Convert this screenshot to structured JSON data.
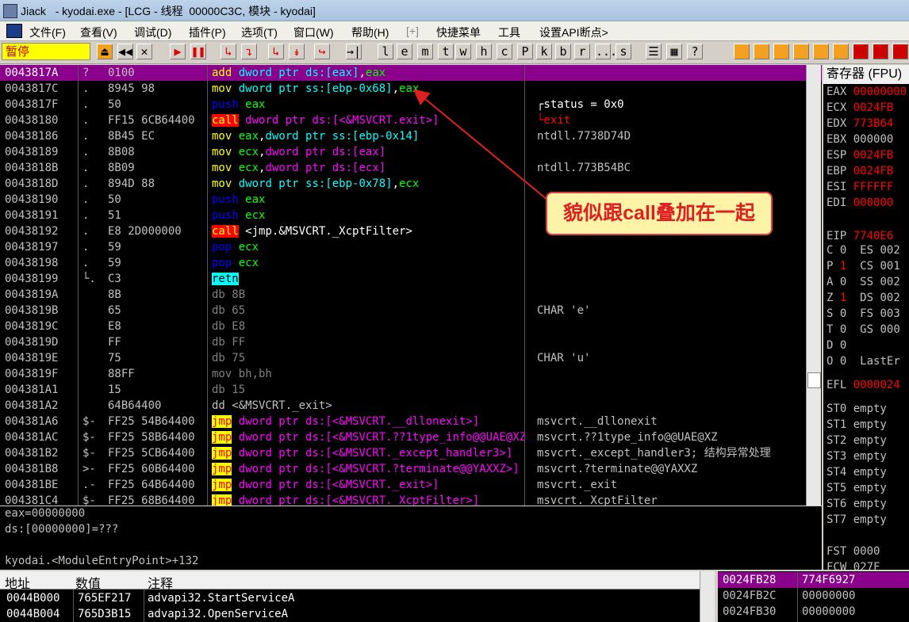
{
  "window": {
    "title": "Jiack   - kyodai.exe - [LCG - 线程  00000C3C, 模块 - kyodai]"
  },
  "menu": [
    "文件(F)",
    "查看(V)",
    "调试(D)",
    "插件(P)",
    "选项(T)",
    "窗口(W)",
    "帮助(H)",
    "[+]",
    "快捷菜单",
    "工具",
    "设置API断点>"
  ],
  "toolbar": {
    "status": "暂停",
    "buttons": [
      "⏏",
      "◀◀",
      "✕",
      "▶",
      "❚❚",
      "↳",
      "↴",
      "↳",
      "↡",
      "↪",
      "→|",
      "l",
      "e",
      "m",
      "t",
      "w",
      "h",
      "c",
      "P",
      "k",
      "b",
      "r",
      "...",
      "s",
      "☰",
      "▦",
      "?"
    ]
  },
  "cpu": {
    "rows": [
      {
        "addr": "0043817A",
        "mark": "?",
        "hex": "0100",
        "mn": "add",
        "mnc": "add",
        "ops": [
          [
            "dword ptr ds:[eax]",
            "mem"
          ],
          [
            ",",
            "plain"
          ],
          [
            "eax",
            "reg"
          ]
        ],
        "cm": "",
        "sel": true
      },
      {
        "addr": "0043817C",
        "mark": ".",
        "hex": "8945 98",
        "mn": "mov",
        "mnc": "mov",
        "ops": [
          [
            "dword ptr ss:[ebp-0x68]",
            "mem"
          ],
          [
            ",",
            "plain"
          ],
          [
            "eax",
            "reg"
          ]
        ],
        "cm": ""
      },
      {
        "addr": "0043817F",
        "mark": ".",
        "hex": "50",
        "mn": "push",
        "mnc": "push",
        "ops": [
          [
            "eax",
            "reg"
          ]
        ],
        "cm": "┌status = 0x0"
      },
      {
        "addr": "00438180",
        "mark": ".",
        "hex": "FF15 6CB64400",
        "mn": "call",
        "mnc": "call",
        "ops": [
          [
            "dword ptr ds:[<&MSVCRT.exit>]",
            "jmem"
          ]
        ],
        "cm": "└exit",
        "cmred": true
      },
      {
        "addr": "00438186",
        "mark": ".",
        "hex": "8B45 EC",
        "mn": "mov",
        "mnc": "mov",
        "ops": [
          [
            "eax",
            "reg"
          ],
          [
            ",",
            "plain"
          ],
          [
            "dword ptr ss:[ebp-0x14]",
            "mem"
          ]
        ],
        "cm": "ntdll.7738D74D"
      },
      {
        "addr": "00438189",
        "mark": ".",
        "hex": "8B08",
        "mn": "mov",
        "mnc": "mov",
        "ops": [
          [
            "ecx",
            "reg"
          ],
          [
            ",",
            "plain"
          ],
          [
            "dword ptr ds:[eax]",
            "jmem"
          ]
        ],
        "cm": ""
      },
      {
        "addr": "0043818B",
        "mark": ".",
        "hex": "8B09",
        "mn": "mov",
        "mnc": "mov",
        "ops": [
          [
            "ecx",
            "reg"
          ],
          [
            ",",
            "plain"
          ],
          [
            "dword ptr ds:[ecx]",
            "jmem"
          ]
        ],
        "cm": "ntdll.773B54BC"
      },
      {
        "addr": "0043818D",
        "mark": ".",
        "hex": "894D 88",
        "mn": "mov",
        "mnc": "mov",
        "ops": [
          [
            "dword ptr ss:[ebp-0x78]",
            "mem"
          ],
          [
            ",",
            "plain"
          ],
          [
            "ecx",
            "reg"
          ]
        ],
        "cm": ""
      },
      {
        "addr": "00438190",
        "mark": ".",
        "hex": "50",
        "mn": "push",
        "mnc": "push",
        "ops": [
          [
            "eax",
            "reg"
          ]
        ],
        "cm": ""
      },
      {
        "addr": "00438191",
        "mark": ".",
        "hex": "51",
        "mn": "push",
        "mnc": "push",
        "ops": [
          [
            "ecx",
            "reg"
          ]
        ],
        "cm": ""
      },
      {
        "addr": "00438192",
        "mark": ".",
        "hex": "E8 2D000000",
        "mn": "call",
        "mnc": "call",
        "ops": [
          [
            "<jmp.&MSVCRT._XcptFilter>",
            "plain"
          ]
        ],
        "cm": ""
      },
      {
        "addr": "00438197",
        "mark": ".",
        "hex": "59",
        "mn": "pop",
        "mnc": "pop",
        "ops": [
          [
            "ecx",
            "reg"
          ]
        ],
        "cm": ""
      },
      {
        "addr": "00438198",
        "mark": ".",
        "hex": "59",
        "mn": "pop",
        "mnc": "pop",
        "ops": [
          [
            "ecx",
            "reg"
          ]
        ],
        "cm": ""
      },
      {
        "addr": "00438199",
        "mark": "└.",
        "hex": "C3",
        "mn": "retn",
        "mnc": "retn",
        "ops": [],
        "cm": ""
      },
      {
        "addr": "0043819A",
        "mark": "",
        "hex": "8B",
        "mn": "db 8B",
        "mnc": "db",
        "ops": [],
        "cm": ""
      },
      {
        "addr": "0043819B",
        "mark": "",
        "hex": "65",
        "mn": "db 65",
        "mnc": "db",
        "ops": [],
        "cm": "CHAR 'e'"
      },
      {
        "addr": "0043819C",
        "mark": "",
        "hex": "E8",
        "mn": "db E8",
        "mnc": "db",
        "ops": [],
        "cm": ""
      },
      {
        "addr": "0043819D",
        "mark": "",
        "hex": "FF",
        "mn": "db FF",
        "mnc": "db",
        "ops": [],
        "cm": ""
      },
      {
        "addr": "0043819E",
        "mark": "",
        "hex": "75",
        "mn": "db 75",
        "mnc": "db",
        "ops": [],
        "cm": "CHAR 'u'"
      },
      {
        "addr": "0043819F",
        "mark": "",
        "hex": "88FF",
        "mn": "mov bh,bh",
        "mnc": "bh",
        "ops": [],
        "cm": ""
      },
      {
        "addr": "004381A1",
        "mark": "",
        "hex": "15",
        "mn": "db 15",
        "mnc": "db",
        "ops": [],
        "cm": ""
      },
      {
        "addr": "004381A2",
        "mark": "",
        "hex": "64B64400",
        "mn": "dd <&MSVCRT._exit>",
        "mnc": "dd",
        "ops": [],
        "cm": ""
      },
      {
        "addr": "004381A6",
        "mark": "$-",
        "hex": "FF25 54B64400",
        "mn": "jmp",
        "mnc": "jmp",
        "ops": [
          [
            "dword ptr ds:[<&MSVCRT.__dllonexit>]",
            "jmem"
          ]
        ],
        "cm": "msvcrt.__dllonexit"
      },
      {
        "addr": "004381AC",
        "mark": "$-",
        "hex": "FF25 58B64400",
        "mn": "jmp",
        "mnc": "jmp",
        "ops": [
          [
            "dword ptr ds:[<&MSVCRT.??1type_info@@UAE@XZ>]",
            "jmem"
          ]
        ],
        "cm": "msvcrt.??1type_info@@UAE@XZ"
      },
      {
        "addr": "004381B2",
        "mark": "$-",
        "hex": "FF25 5CB64400",
        "mn": "jmp",
        "mnc": "jmp",
        "ops": [
          [
            "dword ptr ds:[<&MSVCRT._except_handler3>]",
            "jmem"
          ]
        ],
        "cm": "msvcrt._except_handler3; 结构异常处理"
      },
      {
        "addr": "004381B8",
        "mark": ">-",
        "hex": "FF25 60B64400",
        "mn": "jmp",
        "mnc": "jmp",
        "ops": [
          [
            "dword ptr ds:[<&MSVCRT.?terminate@@YAXXZ>]",
            "jmem"
          ]
        ],
        "cm": "msvcrt.?terminate@@YAXXZ"
      },
      {
        "addr": "004381BE",
        "mark": ".-",
        "hex": "FF25 64B64400",
        "mn": "jmp",
        "mnc": "jmp",
        "ops": [
          [
            "dword ptr ds:[<&MSVCRT._exit>]",
            "jmem"
          ]
        ],
        "cm": "msvcrt._exit"
      },
      {
        "addr": "004381C4",
        "mark": "$-",
        "hex": "FF25 68B64400",
        "mn": "jmp",
        "mnc": "jmp",
        "ops": [
          [
            "dword ptr ds:[<&MSVCRT._XcptFilter>]",
            "jmem"
          ]
        ],
        "cm": "msvcrt._XcptFilter"
      }
    ]
  },
  "info": {
    "line1": "eax=00000000",
    "line2": "ds:[00000000]=???",
    "line3": "kyodai.<ModuleEntryPoint>+132"
  },
  "dump": {
    "headers": [
      "地址",
      "数值",
      "注释"
    ],
    "rows": [
      {
        "addr": "0044B000",
        "val": "765EF217",
        "cm": "advapi32.StartServiceA"
      },
      {
        "addr": "0044B004",
        "val": "765D3B15",
        "cm": "advapi32.OpenServiceA"
      }
    ]
  },
  "stack": {
    "rows": [
      {
        "addr": "0024FB28",
        "val": "774F6927",
        "sel": true
      },
      {
        "addr": "0024FB2C",
        "val": "00000000"
      },
      {
        "addr": "0024FB30",
        "val": "00000000"
      }
    ]
  },
  "registers": {
    "title": "寄存器 (FPU)",
    "regs": [
      {
        "n": "EAX",
        "v": "00000000",
        "red": true
      },
      {
        "n": "ECX",
        "v": "0024FB",
        "red": true
      },
      {
        "n": "EDX",
        "v": "773B64",
        "red": true
      },
      {
        "n": "EBX",
        "v": "000000",
        "red": false
      },
      {
        "n": "ESP",
        "v": "0024FB",
        "red": true
      },
      {
        "n": "EBP",
        "v": "0024FB",
        "red": true
      },
      {
        "n": "ESI",
        "v": "FFFFFF",
        "red": true
      },
      {
        "n": "EDI",
        "v": "000000",
        "red": true
      },
      {
        "n": "EIP",
        "v": "7740E6",
        "red": true
      }
    ],
    "flags": [
      {
        "f": "C",
        "v": "0",
        "seg": "ES 002",
        "red": false
      },
      {
        "f": "P",
        "v": "1",
        "seg": "CS 001",
        "red": true
      },
      {
        "f": "A",
        "v": "0",
        "seg": "SS 002",
        "red": false
      },
      {
        "f": "Z",
        "v": "1",
        "seg": "DS 002",
        "red": true
      },
      {
        "f": "S",
        "v": "0",
        "seg": "FS 003",
        "red": false
      },
      {
        "f": "T",
        "v": "0",
        "seg": "GS 000",
        "red": false
      },
      {
        "f": "D",
        "v": "0",
        "seg": "",
        "red": false
      },
      {
        "f": "O",
        "v": "0",
        "seg": "LastEr",
        "red": false
      }
    ],
    "efl": {
      "n": "EFL",
      "v": "0000024"
    },
    "st": [
      "ST0 empty",
      "ST1 empty",
      "ST2 empty",
      "ST3 empty",
      "ST4 empty",
      "ST5 empty",
      "ST6 empty",
      "ST7 empty"
    ],
    "fst": "FST 0000",
    "fcw": "FCW 027F"
  },
  "annotation": {
    "text": "貌似跟call叠加在一起",
    "color": "#e02020",
    "bg": "#fff3a8"
  }
}
